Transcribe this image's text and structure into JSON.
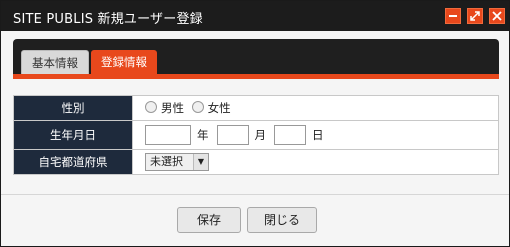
{
  "window": {
    "title": "SITE PUBLIS 新規ユーザー登録"
  },
  "colors": {
    "accent": "#e8481c",
    "titlebar": "#1c1c1c",
    "label_bg": "#1e2a3c"
  },
  "titlebar_buttons": [
    {
      "name": "minimize",
      "icon": "minimize-icon"
    },
    {
      "name": "maximize",
      "icon": "expand-icon"
    },
    {
      "name": "close",
      "icon": "close-icon"
    }
  ],
  "tabs": [
    {
      "label": "基本情報",
      "active": false
    },
    {
      "label": "登録情報",
      "active": true
    }
  ],
  "form": {
    "gender": {
      "label": "性別",
      "options": [
        "男性",
        "女性"
      ]
    },
    "birthdate": {
      "label": "生年月日",
      "year_unit": "年",
      "month_unit": "月",
      "day_unit": "日",
      "year": "",
      "month": "",
      "day": ""
    },
    "prefecture": {
      "label": "自宅都道府県",
      "selected": "未選択"
    }
  },
  "buttons": {
    "save": "保存",
    "close": "閉じる"
  }
}
